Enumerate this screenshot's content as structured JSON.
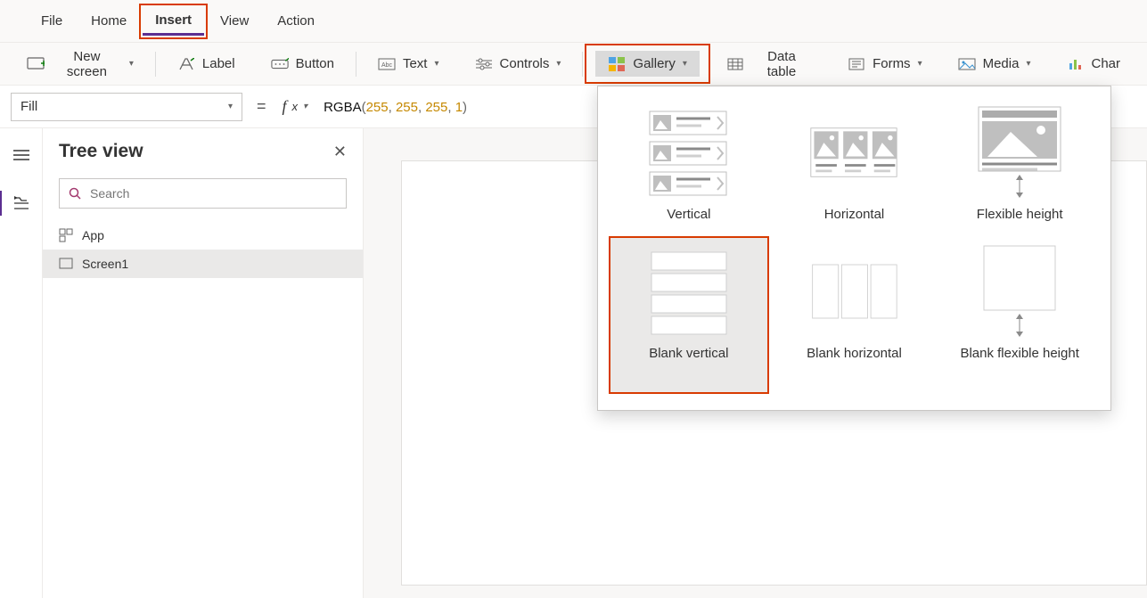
{
  "menu": {
    "items": [
      "File",
      "Home",
      "Insert",
      "View",
      "Action"
    ],
    "active_index": 2,
    "highlight_index": 2
  },
  "toolbar": {
    "new_screen": "New screen",
    "label": "Label",
    "button": "Button",
    "text": "Text",
    "controls": "Controls",
    "gallery": "Gallery",
    "data_table": "Data table",
    "forms": "Forms",
    "media": "Media",
    "charts": "Char"
  },
  "formula": {
    "property": "Fill",
    "equals": "=",
    "fx": "fx",
    "fn": "RGBA",
    "open": "(",
    "a1": "255",
    "c1": ", ",
    "a2": "255",
    "c2": ", ",
    "a3": "255",
    "c3": ", ",
    "a4": "1",
    "close": ")"
  },
  "tree": {
    "title": "Tree view",
    "search_placeholder": "Search",
    "items": [
      {
        "label": "App",
        "selected": false
      },
      {
        "label": "Screen1",
        "selected": true
      }
    ]
  },
  "gallery_menu": {
    "items": [
      {
        "label": "Vertical"
      },
      {
        "label": "Horizontal"
      },
      {
        "label": "Flexible height"
      },
      {
        "label": "Blank vertical"
      },
      {
        "label": "Blank horizontal"
      },
      {
        "label": "Blank flexible height"
      }
    ],
    "selected_index": 3,
    "highlight_index": 3
  }
}
